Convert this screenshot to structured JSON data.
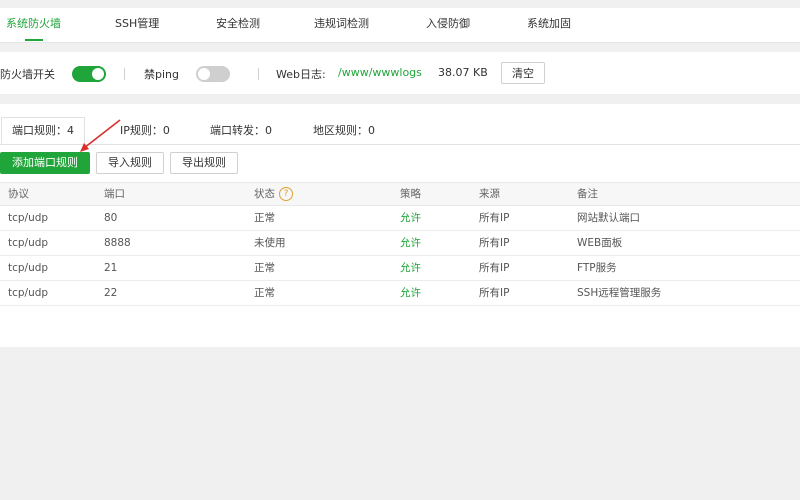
{
  "tabs": [
    {
      "label": "系统防火墙",
      "active": true
    },
    {
      "label": "SSH管理",
      "active": false
    },
    {
      "label": "安全检测",
      "active": false
    },
    {
      "label": "违规词检测",
      "active": false
    },
    {
      "label": "入侵防御",
      "active": false
    },
    {
      "label": "系统加固",
      "active": false
    }
  ],
  "controls": {
    "firewall_label": "防火墙开关",
    "firewall_on": true,
    "ping_label": "禁ping",
    "ping_on": false,
    "weblog_label": "Web日志:",
    "weblog_path": "/www/wwwlogs",
    "weblog_size": "38.07 KB",
    "clear_label": "清空"
  },
  "subtabs": [
    {
      "label": "端口规则：4",
      "active": true
    },
    {
      "label": "IP规则：0",
      "active": false
    },
    {
      "label": "端口转发：0",
      "active": false
    },
    {
      "label": "地区规则：0",
      "active": false
    }
  ],
  "actions": {
    "add_label": "添加端口规则",
    "import_label": "导入规则",
    "export_label": "导出规则"
  },
  "table": {
    "headers": [
      "协议",
      "端口",
      "状态",
      "策略",
      "来源",
      "备注"
    ],
    "help_glyph": "?",
    "rows": [
      [
        "tcp/udp",
        "80",
        "正常",
        "允许",
        "所有IP",
        "网站默认端口"
      ],
      [
        "tcp/udp",
        "8888",
        "未使用",
        "允许",
        "所有IP",
        "WEB面板"
      ],
      [
        "tcp/udp",
        "21",
        "正常",
        "允许",
        "所有IP",
        "FTP服务"
      ],
      [
        "tcp/udp",
        "22",
        "正常",
        "允许",
        "所有IP",
        "SSH远程管理服务"
      ]
    ]
  },
  "colors": {
    "accent": "#20a53a",
    "annotation_arrow": "#d9302c"
  }
}
